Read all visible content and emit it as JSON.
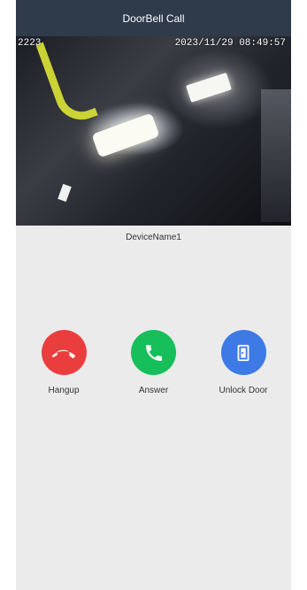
{
  "header": {
    "title": "DoorBell Call"
  },
  "camera": {
    "channel_id": "2223",
    "timestamp": "2023/11/29 08:49:57"
  },
  "device": {
    "name": "DeviceName1"
  },
  "actions": [
    {
      "label": "Hangup",
      "icon": "phone-hangup-icon",
      "color": "#ea3e3e"
    },
    {
      "label": "Answer",
      "icon": "phone-answer-icon",
      "color": "#17bf5a"
    },
    {
      "label": "Unlock Door",
      "icon": "door-unlock-icon",
      "color": "#3d7ae6"
    }
  ]
}
